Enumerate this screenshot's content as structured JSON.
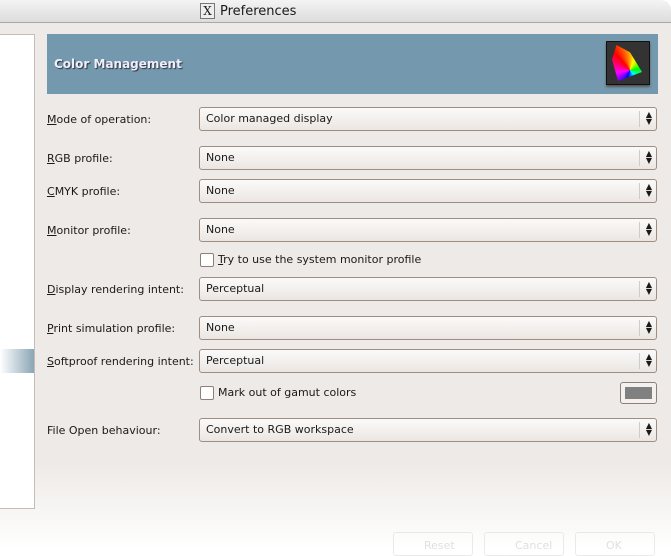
{
  "window": {
    "title": "Preferences",
    "icon": "x-window-icon"
  },
  "banner": {
    "title": "Color Management",
    "icon": "color-gamut-icon",
    "color": "#7499ae"
  },
  "fields": [
    {
      "key": "M",
      "rest": "ode of operation:",
      "value": "Color managed display"
    },
    {
      "key": "R",
      "rest": "GB profile:",
      "value": "None"
    },
    {
      "key": "C",
      "rest": "MYK profile:",
      "value": "None"
    },
    {
      "key": "M",
      "rest": "onitor profile:",
      "value": "None"
    },
    {
      "key": "D",
      "rest": "isplay rendering intent:",
      "value": "Perceptual"
    },
    {
      "key": "P",
      "rest": "rint simulation profile:",
      "value": "None"
    },
    {
      "key": "S",
      "rest": "oftproof rendering intent:",
      "value": "Perceptual"
    },
    {
      "key": "",
      "rest": "File Open behaviour:",
      "value": "Convert to RGB workspace"
    }
  ],
  "checks": {
    "system_monitor": {
      "key": "T",
      "rest": "ry to use the system monitor profile",
      "checked": false
    },
    "gamut": {
      "label": "Mark out of gamut colors",
      "checked": false,
      "color": "#808080"
    }
  },
  "buttons": {
    "reset": "Reset",
    "cancel": "Cancel",
    "ok": "OK"
  }
}
